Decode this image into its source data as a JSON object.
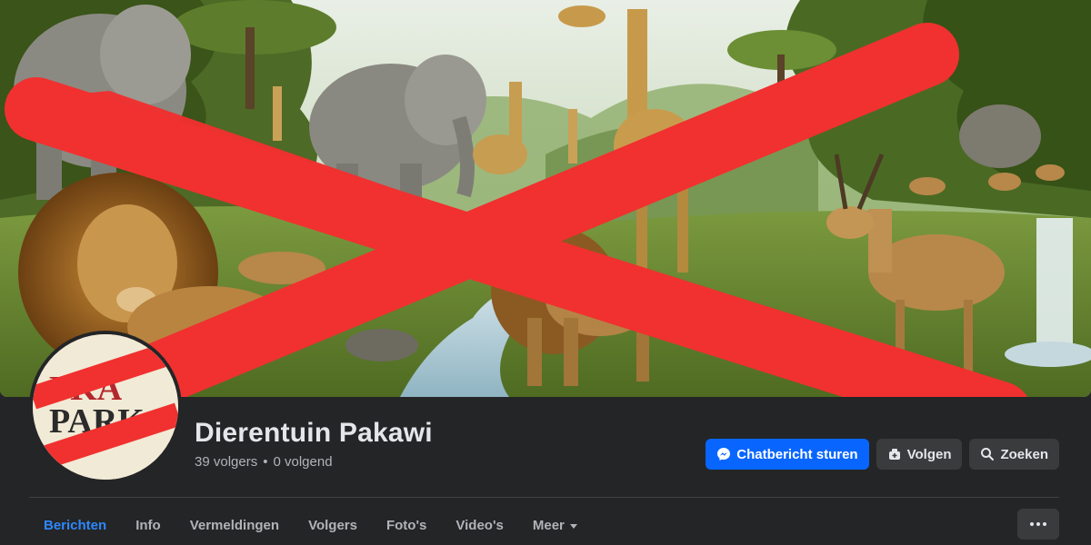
{
  "page": {
    "name": "Dierentuin Pakawi",
    "followers": "39 volgers",
    "separator": "•",
    "following": "0 volgend"
  },
  "avatar": {
    "logo_text_top": "PKA",
    "logo_text_bottom": "PARK"
  },
  "actions": {
    "message_label": "Chatbericht sturen",
    "follow_label": "Volgen",
    "search_label": "Zoeken"
  },
  "tabs": [
    {
      "label": "Berichten",
      "active": true
    },
    {
      "label": "Info"
    },
    {
      "label": "Vermeldingen"
    },
    {
      "label": "Volgers"
    },
    {
      "label": "Foto's"
    },
    {
      "label": "Video's"
    },
    {
      "label": "Meer"
    }
  ],
  "colors": {
    "background": "#242526",
    "primary_button": "#0866ff",
    "active_tab": "#2d88ff",
    "cross": "#f0312f"
  },
  "icons": {
    "message": "messenger-icon",
    "follow": "follow-icon",
    "search": "search-icon",
    "more": "more-dots-icon"
  }
}
